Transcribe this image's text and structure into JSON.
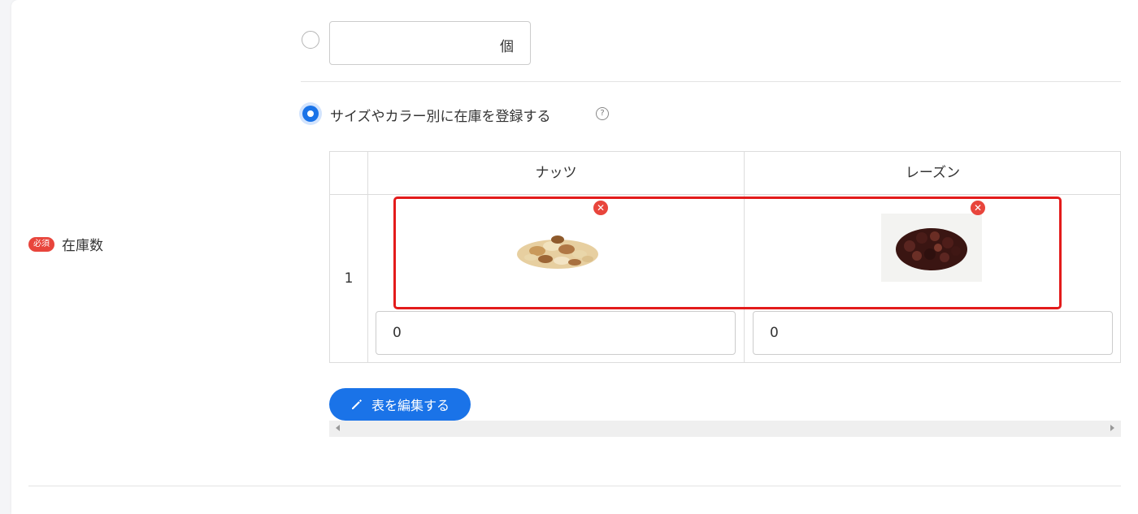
{
  "field": {
    "required_badge": "必須",
    "label": "在庫数"
  },
  "option_simple": {
    "unit": "個"
  },
  "option_variant": {
    "label": "サイズやカラー別に在庫を登録する",
    "help_icon": "question-circle-icon"
  },
  "table": {
    "columns": [
      "ナッツ",
      "レーズン"
    ],
    "rows": [
      {
        "number": "1",
        "values": [
          "0",
          "0"
        ]
      }
    ]
  },
  "edit_button": {
    "label": "表を編集する",
    "icon": "pencil-icon"
  },
  "colors": {
    "accent": "#1a73e8",
    "required": "#e8453c",
    "highlight": "#e31b1b"
  }
}
